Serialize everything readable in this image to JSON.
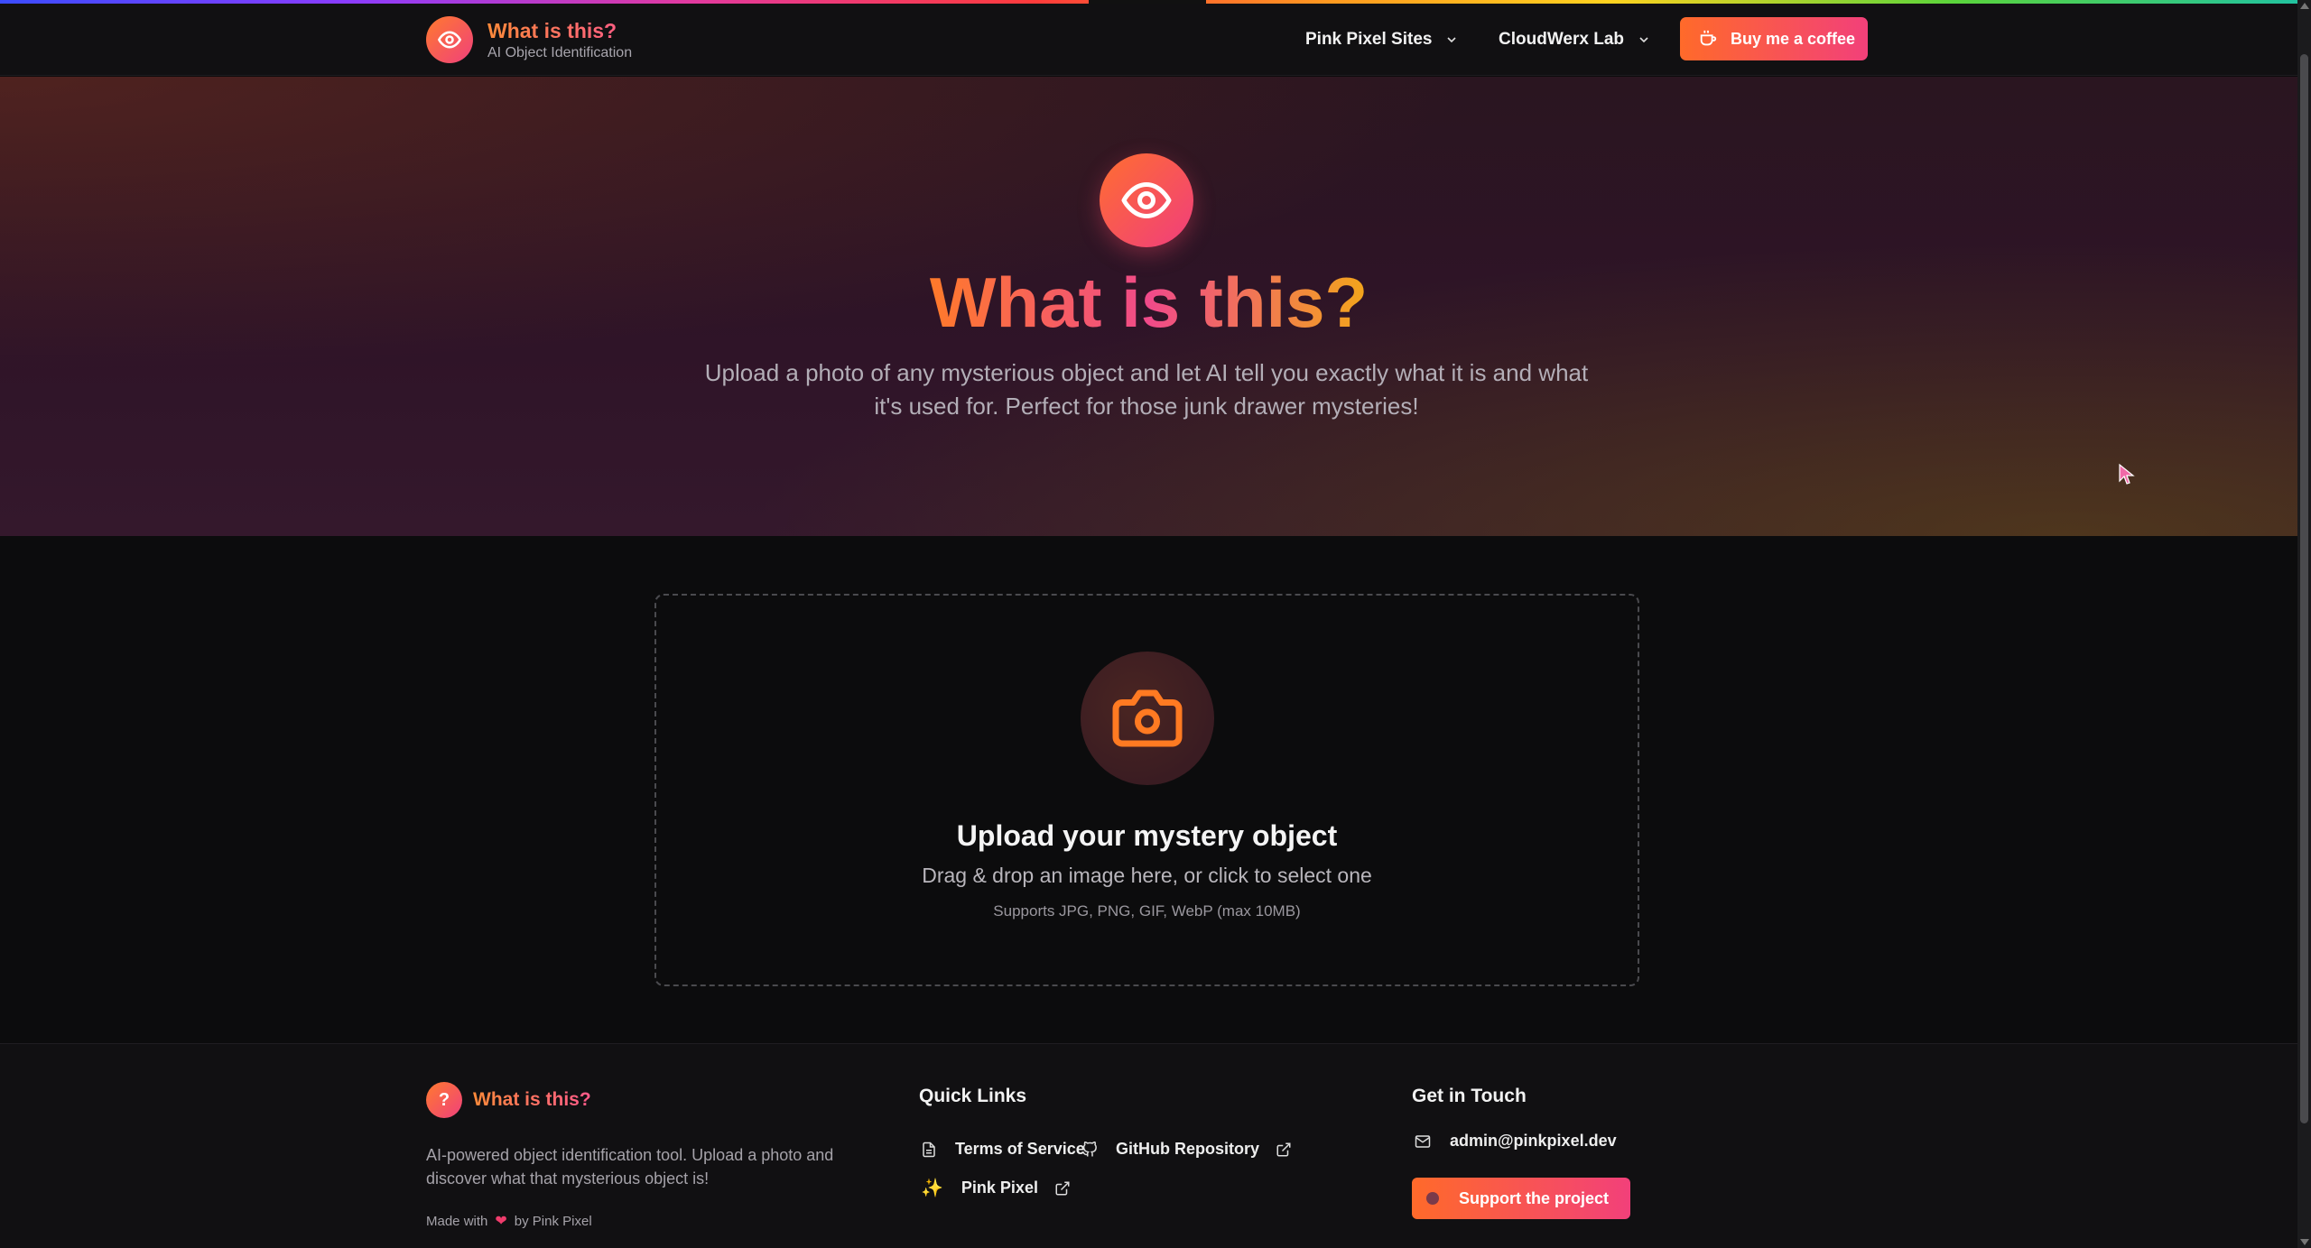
{
  "header": {
    "brand_title": "What is this?",
    "brand_subtitle": "AI Object Identification",
    "nav": [
      {
        "label": "Pink Pixel Sites"
      },
      {
        "label": "CloudWerx Lab"
      }
    ],
    "coffee_label": "Buy me a coffee"
  },
  "hero": {
    "title": "What is this?",
    "description": "Upload a photo of any mysterious object and let AI tell you exactly what it is and what it's used for. Perfect for those junk drawer mysteries!"
  },
  "upload": {
    "title": "Upload your mystery object",
    "subtitle": "Drag & drop an image here, or click to select one",
    "note": "Supports JPG, PNG, GIF, WebP (max 10MB)"
  },
  "footer": {
    "brand_glyph": "?",
    "brand_title": "What is this?",
    "description": "AI-powered object identification tool. Upload a photo and discover what that mysterious object is!",
    "made_with": "Made with",
    "made_by": "by Pink Pixel",
    "quick_links_title": "Quick Links",
    "links": {
      "terms": "Terms of Service",
      "github": "GitHub Repository",
      "pinkpixel": "Pink Pixel"
    },
    "contact_title": "Get in Touch",
    "email": "admin@pinkpixel.dev",
    "support_label": "Support the project"
  },
  "colors": {
    "accent_orange": "#ff6a2a",
    "accent_pink": "#f2407a",
    "background": "#0b0b0c"
  }
}
